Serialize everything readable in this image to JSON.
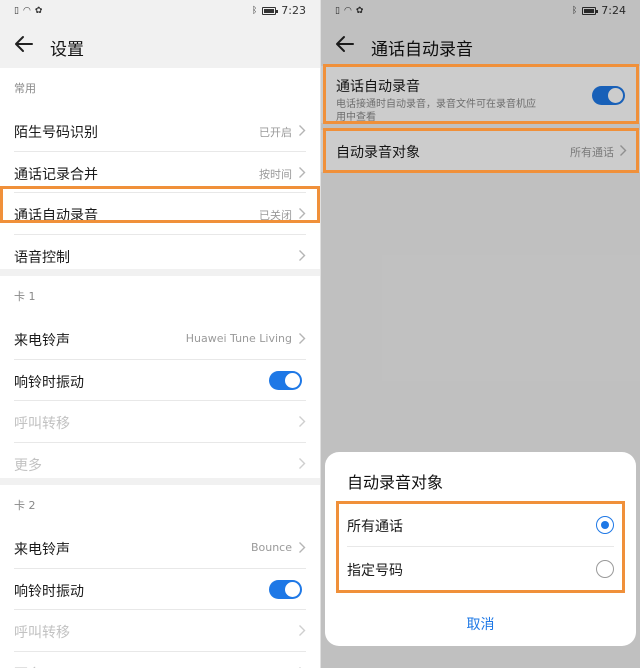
{
  "left": {
    "status": {
      "time": "7:23"
    },
    "header": {
      "title": "设置"
    },
    "sections": [
      {
        "header": "常用",
        "rows": [
          {
            "label": "陌生号码识别",
            "value": "已开启"
          },
          {
            "label": "通话记录合并",
            "value": "按时间"
          },
          {
            "label": "通话自动录音",
            "value": "已关闭"
          },
          {
            "label": "语音控制",
            "value": ""
          }
        ]
      },
      {
        "header": "卡 1",
        "rows": [
          {
            "label": "来电铃声",
            "value": "Huawei Tune Living"
          },
          {
            "label": "响铃时振动",
            "toggle": true
          },
          {
            "label": "呼叫转移",
            "disabled": true
          },
          {
            "label": "更多",
            "disabled": true
          }
        ]
      },
      {
        "header": "卡 2",
        "rows": [
          {
            "label": "来电铃声",
            "value": "Bounce"
          },
          {
            "label": "响铃时振动",
            "toggle": true
          },
          {
            "label": "呼叫转移",
            "disabled": true
          },
          {
            "label": "更多",
            "disabled": true
          }
        ]
      }
    ]
  },
  "right": {
    "status": {
      "time": "7:24"
    },
    "header": {
      "title": "通话自动录音"
    },
    "auto_record": {
      "label": "通话自动录音",
      "desc_line1": "电话接通时自动录音，录音文件可在录音机应",
      "desc_line2": "用中查看",
      "enabled": true
    },
    "target": {
      "label": "自动录音对象",
      "value": "所有通话"
    },
    "sheet": {
      "title": "自动录音对象",
      "options": [
        {
          "label": "所有通话",
          "selected": true
        },
        {
          "label": "指定号码",
          "selected": false
        }
      ],
      "cancel": "取消"
    }
  },
  "colors": {
    "accent": "#1e78e6",
    "highlight": "#f0903a"
  }
}
